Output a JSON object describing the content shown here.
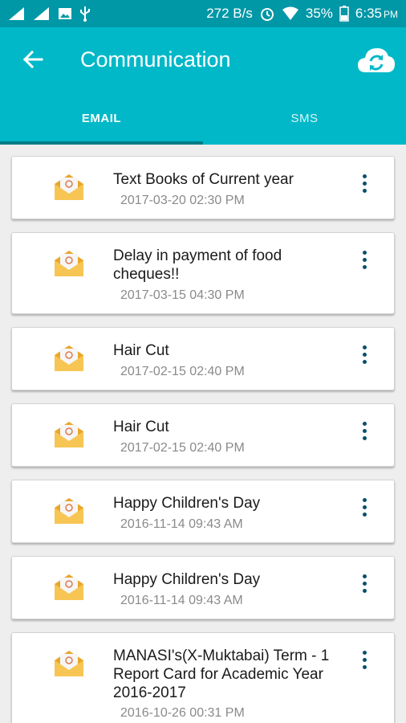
{
  "status_bar": {
    "speed": "272 B/s",
    "battery": "35%",
    "time": "6:35",
    "time_suffix": "PM"
  },
  "header": {
    "title": "Communication",
    "back_icon": "arrow-left-icon",
    "sync_icon": "cloud-sync-icon"
  },
  "tabs": [
    {
      "label": "EMAIL",
      "active": true
    },
    {
      "label": "SMS",
      "active": false
    }
  ],
  "messages": [
    {
      "subject": "Text Books of Current year",
      "date": "2017-03-20 02:30 PM"
    },
    {
      "subject": "Delay in payment of food cheques!!",
      "date": "2017-03-15 04:30 PM"
    },
    {
      "subject": "Hair Cut",
      "date": "2017-02-15 02:40 PM"
    },
    {
      "subject": "Hair Cut",
      "date": "2017-02-15 02:40 PM"
    },
    {
      "subject": "Happy Children's Day",
      "date": "2016-11-14 09:43 AM"
    },
    {
      "subject": "Happy Children's Day",
      "date": "2016-11-14 09:43 AM"
    },
    {
      "subject": "MANASI's(X-Muktabai) Term - 1 Report Card for Academic Year 2016-2017",
      "date": "2016-10-26 00:31 PM"
    }
  ],
  "colors": {
    "status_bar": "#0097a7",
    "app_bar": "#00b8c8",
    "tab_indicator": "#007c88",
    "envelope": "#f5c04a",
    "more_dots": "#0b4f6c"
  }
}
